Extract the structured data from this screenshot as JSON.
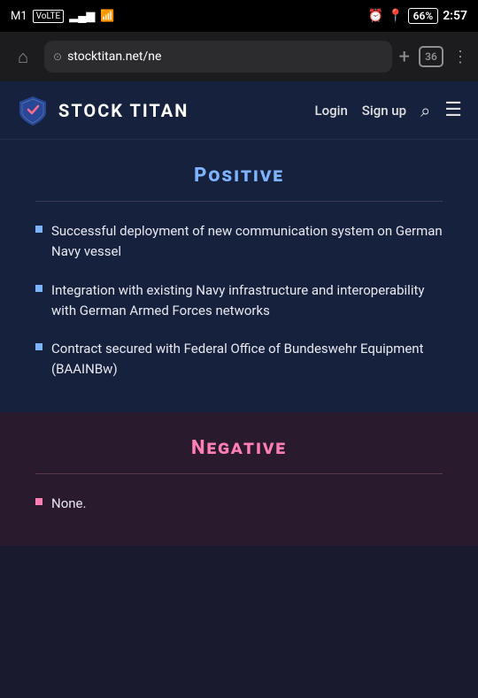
{
  "statusBar": {
    "carrier": "M1",
    "carrierType": "VoLTE",
    "signal": "signal",
    "wifi": "wifi",
    "alarm": "alarm",
    "location": "location",
    "battery": "66",
    "time": "2:57"
  },
  "browserBar": {
    "url": "stocktitan.net/ne",
    "tabCount": "36"
  },
  "siteHeader": {
    "logoAlt": "Stock Titan Shield Logo",
    "siteName": "STOCK TITAN",
    "navLogin": "Login",
    "navSignup": "Sign up"
  },
  "positiveSection": {
    "title": "Positive",
    "divider": true,
    "bullets": [
      "Successful deployment of new communication system on German Navy vessel",
      "Integration with existing Navy infrastructure and interoperability with German Armed Forces networks",
      "Contract secured with Federal Office of Bundeswehr Equipment (BAAINBw)"
    ]
  },
  "negativeSection": {
    "title": "Negative",
    "divider": true,
    "bullets": [
      "None."
    ]
  }
}
